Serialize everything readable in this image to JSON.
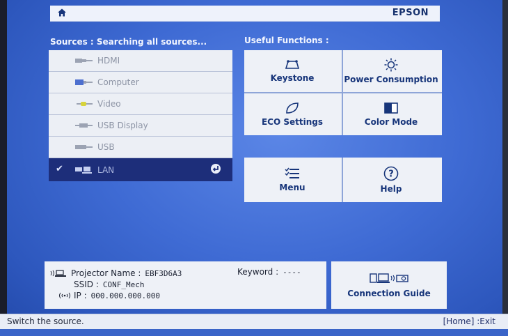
{
  "header": {
    "brand": "EPSON",
    "home_icon": "home-icon"
  },
  "sources": {
    "title": "Sources : Searching all sources...",
    "items": [
      {
        "label": "HDMI",
        "icon": "hdmi-icon"
      },
      {
        "label": "Computer",
        "icon": "computer-port-icon"
      },
      {
        "label": "Video",
        "icon": "video-port-icon"
      },
      {
        "label": "USB Display",
        "icon": "usb-display-icon"
      },
      {
        "label": "USB",
        "icon": "usb-icon"
      },
      {
        "label": "LAN",
        "icon": "lan-icon",
        "selected": true
      }
    ]
  },
  "functions": {
    "title": "Useful Functions :",
    "tiles": [
      {
        "label": "Keystone",
        "icon": "keystone-icon"
      },
      {
        "label": "Power Consumption",
        "icon": "sun-icon"
      },
      {
        "label": "ECO Settings",
        "icon": "leaf-icon"
      },
      {
        "label": "Color Mode",
        "icon": "color-mode-icon"
      },
      {
        "label": "Menu",
        "icon": "menu-list-icon"
      },
      {
        "label": "Help",
        "icon": "help-circle-icon"
      }
    ]
  },
  "info": {
    "projector_name_label": "Projector Name :",
    "projector_name_value": "EBF3D6A3",
    "ssid_label": "SSID :",
    "ssid_value": "CONF_Mech",
    "ip_label": "IP :",
    "ip_value": "000.000.000.000",
    "keyword_label": "Keyword :",
    "keyword_value": "----"
  },
  "connection_guide": {
    "label": "Connection Guide"
  },
  "footer": {
    "hint": "Switch the source.",
    "shortcut": "[Home] :Exit"
  },
  "colors": {
    "selected_row": "#1d2e7a",
    "panel": "#eef1f7",
    "background": "#3f6bd4",
    "text_blue": "#17357a"
  }
}
